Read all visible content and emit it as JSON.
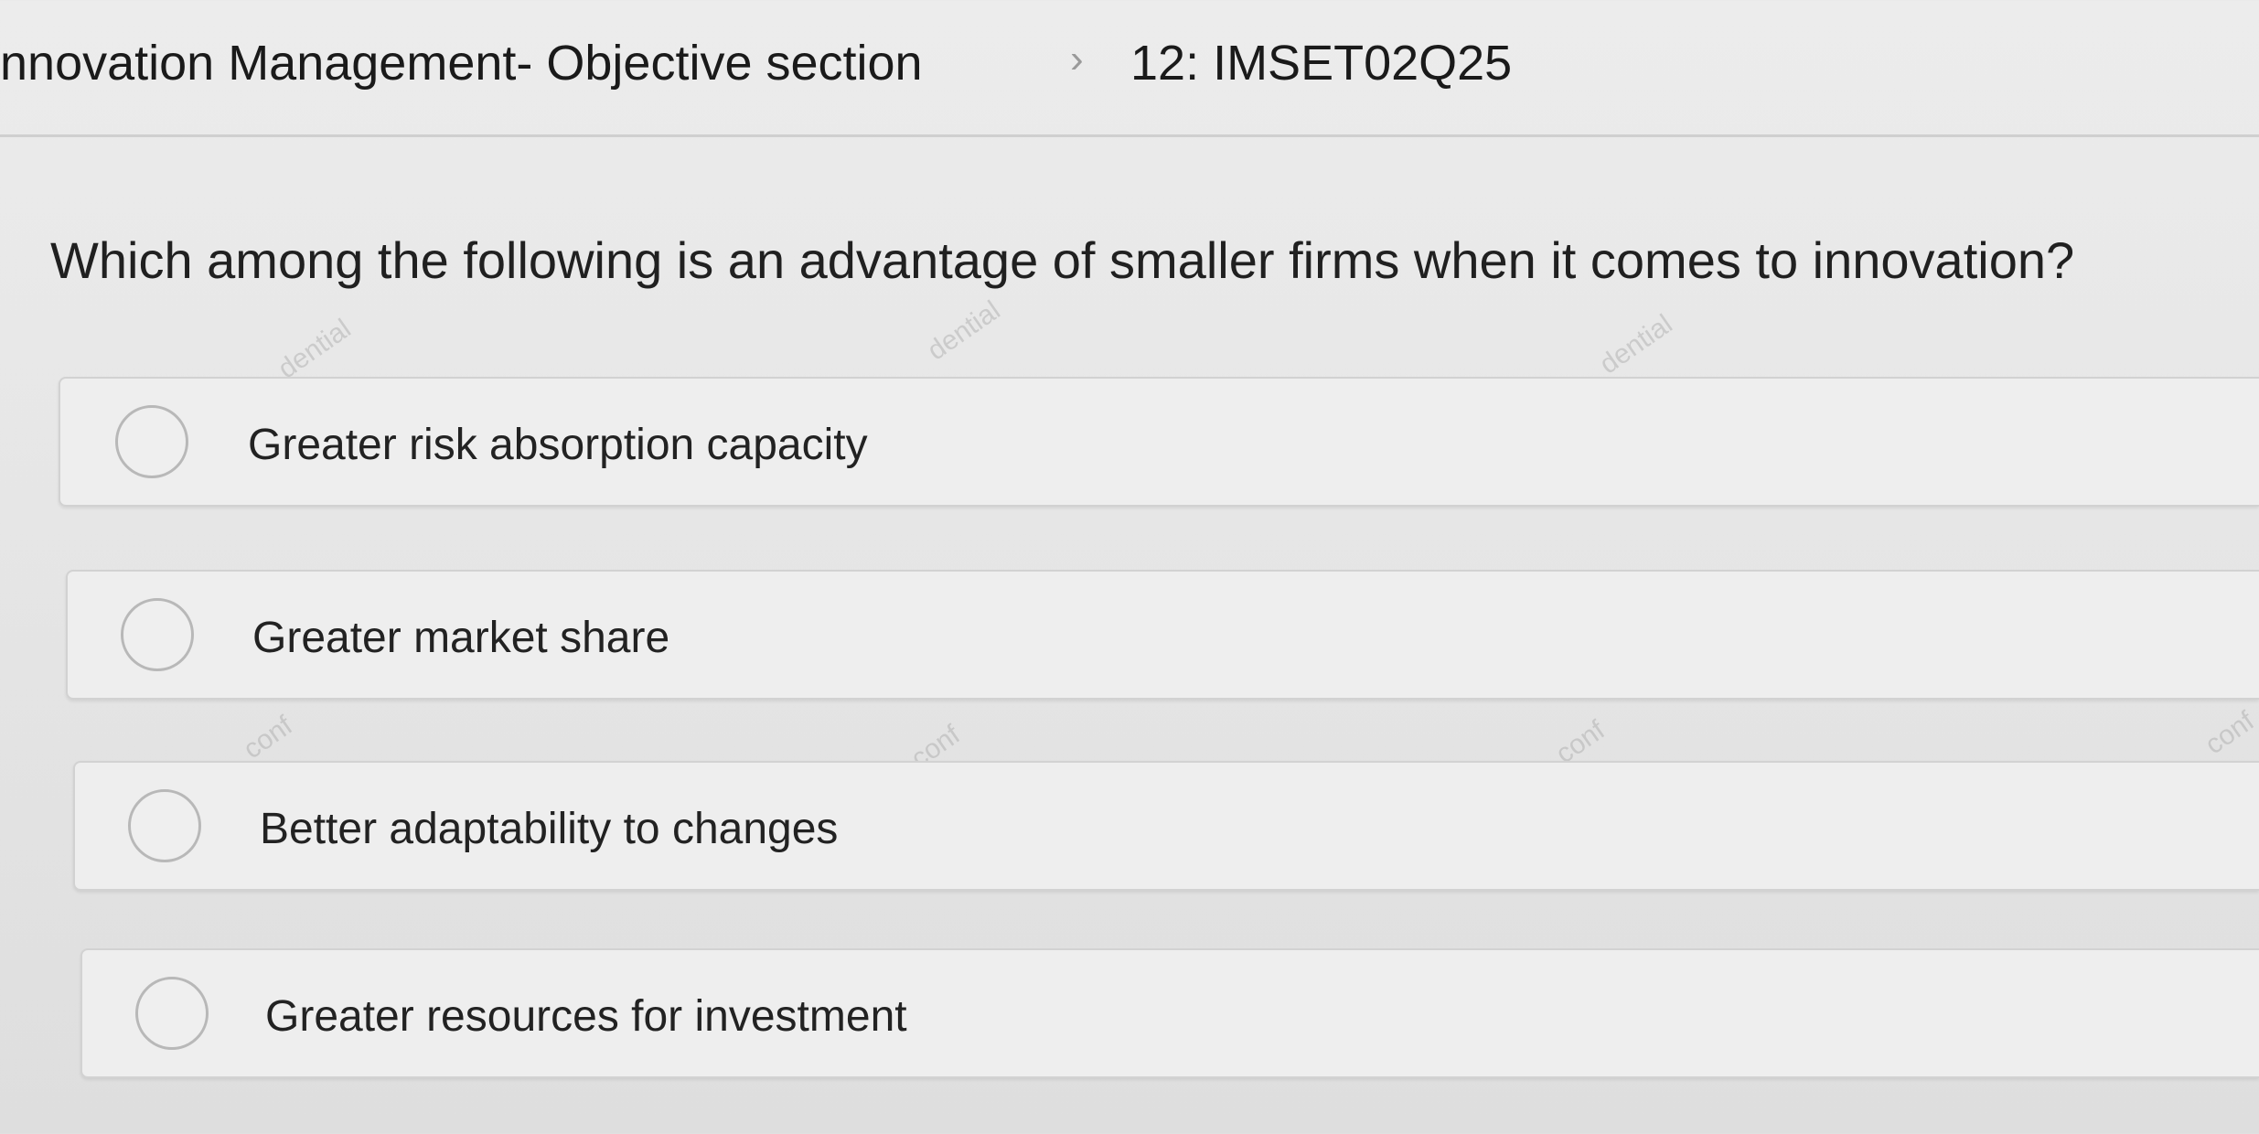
{
  "breadcrumb": {
    "parent": "nnovation Management- Objective section",
    "separator": "›",
    "current": "12: IMSET02Q25"
  },
  "question": {
    "text": "Which among the following is an advantage of smaller firms when it comes to innovation?"
  },
  "options": [
    {
      "label": "Greater risk absorption capacity",
      "selected": false
    },
    {
      "label": "Greater market share",
      "selected": false
    },
    {
      "label": "Better adaptability to changes",
      "selected": false
    },
    {
      "label": "Greater resources for investment",
      "selected": false
    }
  ],
  "watermark": {
    "upper": "dential",
    "lower": "conf"
  },
  "icons": [
    "chevron-right-icon",
    "radio-unchecked-icon"
  ]
}
